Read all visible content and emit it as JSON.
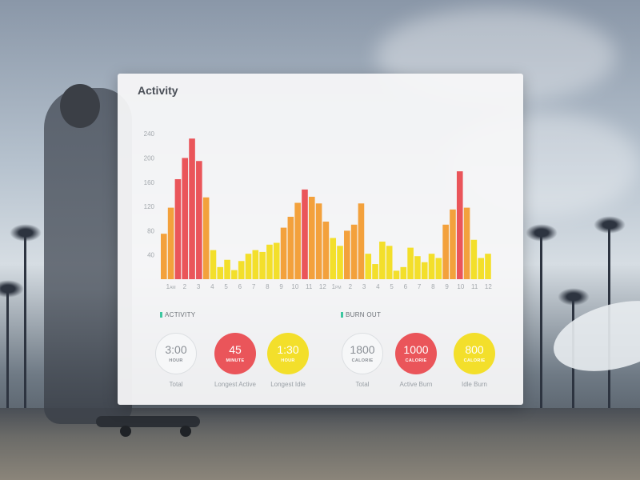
{
  "card": {
    "title": "Activity"
  },
  "colors": {
    "red": "#ea555a",
    "orange": "#f3a13c",
    "yellow": "#f3df2b",
    "accent": "#3ec7a0"
  },
  "chart_data": {
    "type": "bar",
    "y_ticks": [
      "240",
      "200",
      "160",
      "120",
      "80",
      "40"
    ],
    "ylim": [
      0,
      260
    ],
    "x_labels": [
      "1AM",
      "2",
      "3",
      "4",
      "5",
      "6",
      "7",
      "8",
      "9",
      "10",
      "11",
      "12",
      "1PM",
      "2",
      "3",
      "4",
      "5",
      "6",
      "7",
      "8",
      "9",
      "10",
      "11",
      "12"
    ],
    "values": [
      75,
      118,
      165,
      200,
      232,
      195,
      135,
      48,
      20,
      32,
      15,
      30,
      42,
      48,
      45,
      57,
      60,
      85,
      103,
      126,
      148,
      136,
      125,
      95,
      68,
      55,
      80,
      90,
      125,
      42,
      25,
      62,
      55,
      14,
      20,
      52,
      38,
      28,
      42,
      35,
      90,
      115,
      178,
      118,
      65,
      35,
      42
    ]
  },
  "activity": {
    "label": "ACTIVITY",
    "stats": [
      {
        "value": "3:00",
        "unit": "HOUR",
        "caption": "Total"
      },
      {
        "value": "45",
        "unit": "MINUTE",
        "caption": "Longest Active"
      },
      {
        "value": "1:30",
        "unit": "HOUR",
        "caption": "Longest Idle"
      }
    ]
  },
  "burnout": {
    "label": "BURN OUT",
    "stats": [
      {
        "value": "1800",
        "unit": "CALORIE",
        "caption": "Total"
      },
      {
        "value": "1000",
        "unit": "CALORIE",
        "caption": "Active Burn"
      },
      {
        "value": "800",
        "unit": "CALORIE",
        "caption": "Idle Burn"
      }
    ]
  }
}
